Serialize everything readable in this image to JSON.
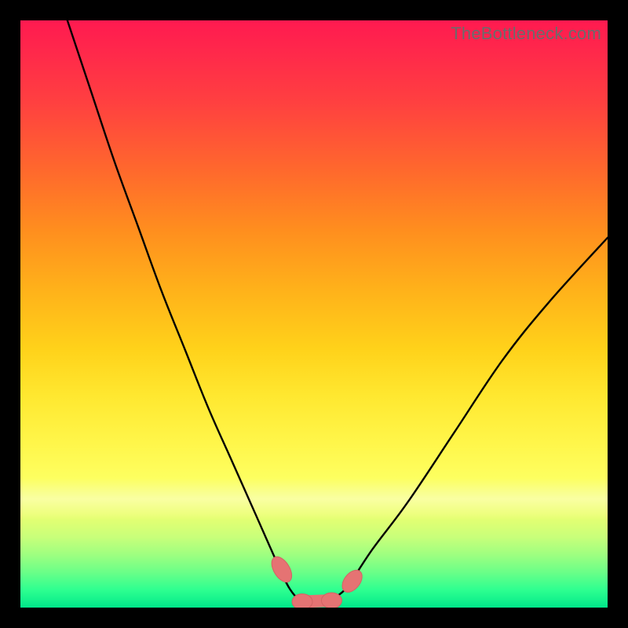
{
  "watermark": "TheBottleneck.com",
  "colors": {
    "frame": "#000000",
    "curve_stroke": "#000000",
    "marker_fill": "#e57373",
    "marker_stroke": "#d26464",
    "gradient_top": "#ff1a50",
    "gradient_bottom": "#00e88a"
  },
  "chart_data": {
    "type": "line",
    "title": "",
    "xlabel": "",
    "ylabel": "",
    "xlim": [
      0,
      100
    ],
    "ylim": [
      0,
      100
    ],
    "note": "y-axis inverted visually: 0 at bottom (green / good), 100 at top (red / bad). Curve is a V-shaped bottleneck profile with minimum ~46–55.",
    "series": [
      {
        "name": "bottleneck-curve",
        "x": [
          8,
          12,
          16,
          20,
          24,
          28,
          32,
          36,
          40,
          44,
          46,
          48,
          50,
          52,
          54,
          56,
          60,
          66,
          74,
          82,
          90,
          100
        ],
        "values": [
          100,
          88,
          76,
          65,
          54,
          44,
          34,
          25,
          16,
          7,
          3,
          1,
          1,
          1,
          2,
          4,
          10,
          18,
          30,
          42,
          52,
          63
        ]
      }
    ],
    "markers": [
      {
        "name": "left-end",
        "x": 44.5,
        "y": 6.5
      },
      {
        "name": "flat-left",
        "x": 48.0,
        "y": 1.0
      },
      {
        "name": "flat-right",
        "x": 53.0,
        "y": 1.2
      },
      {
        "name": "right-end",
        "x": 56.5,
        "y": 4.5
      }
    ],
    "connector": {
      "from": "flat-left",
      "to": "flat-right"
    }
  }
}
